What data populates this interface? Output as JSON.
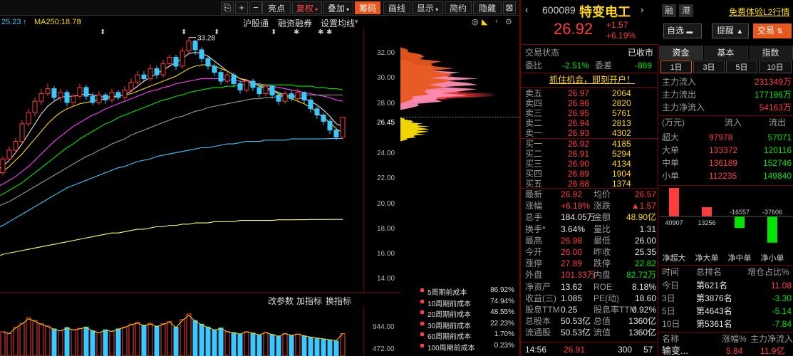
{
  "toolbar": {
    "items": [
      "亮点",
      "复权",
      "叠加",
      "筹码",
      "画线",
      "显示",
      "简约",
      "隐藏"
    ],
    "zoom_in": "+",
    "zoom_out": "−"
  },
  "ma_row": {
    "ma_left": "25.23",
    "ma250": "MA250:18.78",
    "links": [
      "沪股通",
      "融资融券",
      "设置均线"
    ]
  },
  "chart": {
    "ytick_labels": [
      "32.00",
      "30.00",
      "28.00",
      "26.45",
      "24.00",
      "22.00",
      "20.00",
      "18.00",
      "16.00",
      "14.00"
    ],
    "high_label": "33.28",
    "volume_labels": [
      "944.00",
      "472.00"
    ],
    "indicator_buttons": [
      "改参数",
      "加指标",
      "换指标"
    ]
  },
  "chart_data": {
    "type": "candlestick",
    "title": "",
    "ylim": [
      13,
      34
    ],
    "candles": [
      [
        22.5,
        23.6,
        23.8,
        22.3
      ],
      [
        23.6,
        24.3,
        24.6,
        23.4
      ],
      [
        24.3,
        25.0,
        25.3,
        24.1
      ],
      [
        25.0,
        26.4,
        26.7,
        24.8
      ],
      [
        26.4,
        27.3,
        27.6,
        26.2
      ],
      [
        27.3,
        28.2,
        28.5,
        27.0
      ],
      [
        28.2,
        28.8,
        29.2,
        27.9
      ],
      [
        28.8,
        29.2,
        29.6,
        28.6
      ],
      [
        29.2,
        28.5,
        29.4,
        28.2
      ],
      [
        28.5,
        28.9,
        29.2,
        28.2
      ],
      [
        28.9,
        28.1,
        29.1,
        27.8
      ],
      [
        28.1,
        28.6,
        28.8,
        27.8
      ],
      [
        28.6,
        29.3,
        29.6,
        28.4
      ],
      [
        29.3,
        28.6,
        29.5,
        28.3
      ],
      [
        28.6,
        28.1,
        28.9,
        27.9
      ],
      [
        28.1,
        28.7,
        29.0,
        27.9
      ],
      [
        28.7,
        28.3,
        28.9,
        28.0
      ],
      [
        28.3,
        28.9,
        29.2,
        28.1
      ],
      [
        28.9,
        28.5,
        29.1,
        28.3
      ],
      [
        28.5,
        29.1,
        29.4,
        28.3
      ],
      [
        29.1,
        29.7,
        30.0,
        28.9
      ],
      [
        29.7,
        30.3,
        30.6,
        29.5
      ],
      [
        30.3,
        30.0,
        30.6,
        29.7
      ],
      [
        30.0,
        30.8,
        31.1,
        29.8
      ],
      [
        30.8,
        30.3,
        31.0,
        30.0
      ],
      [
        30.3,
        31.2,
        31.5,
        30.1
      ],
      [
        31.2,
        31.7,
        31.9,
        31.0
      ],
      [
        31.7,
        31.0,
        31.9,
        30.7
      ],
      [
        31.0,
        32.2,
        32.5,
        30.8
      ],
      [
        32.2,
        33.0,
        33.28,
        31.9
      ],
      [
        33.0,
        32.3,
        33.1,
        31.9
      ],
      [
        32.3,
        31.6,
        32.5,
        31.3
      ],
      [
        31.6,
        31.0,
        31.8,
        30.7
      ],
      [
        31.0,
        30.5,
        31.2,
        30.2
      ],
      [
        30.5,
        29.8,
        30.7,
        29.5
      ],
      [
        29.8,
        30.3,
        30.6,
        29.6
      ],
      [
        30.3,
        29.6,
        30.5,
        29.3
      ],
      [
        29.6,
        29.1,
        29.8,
        28.8
      ],
      [
        29.1,
        29.8,
        30.0,
        28.9
      ],
      [
        29.8,
        29.3,
        30.0,
        29.0
      ],
      [
        29.3,
        28.8,
        29.5,
        28.5
      ],
      [
        28.8,
        29.4,
        29.6,
        28.6
      ],
      [
        29.4,
        28.7,
        29.5,
        28.4
      ],
      [
        28.7,
        28.2,
        28.9,
        27.9
      ],
      [
        28.2,
        28.8,
        29.0,
        28.0
      ],
      [
        28.8,
        28.4,
        29.1,
        28.2
      ],
      [
        28.4,
        28.9,
        29.2,
        28.2
      ],
      [
        28.9,
        28.3,
        29.0,
        28.0
      ],
      [
        28.3,
        27.6,
        28.5,
        27.3
      ],
      [
        27.6,
        27.1,
        27.8,
        26.8
      ],
      [
        27.1,
        26.6,
        27.3,
        26.3
      ],
      [
        26.6,
        25.9,
        26.8,
        25.6
      ],
      [
        25.9,
        25.35,
        26.1,
        25.1
      ],
      [
        25.35,
        26.92,
        26.98,
        26.0
      ]
    ],
    "ma_lines": [
      {
        "color": "#e6e6e6",
        "values": [
          23.0,
          23.5,
          24.1,
          24.8,
          25.6,
          26.4,
          27.2,
          27.8,
          28.2,
          28.5,
          28.6,
          28.6,
          28.7,
          28.8,
          28.7,
          28.6,
          28.5,
          28.6,
          28.6,
          28.7,
          29.0,
          29.4,
          29.8,
          30.1,
          30.4,
          30.7,
          31.0,
          31.3,
          31.6,
          32.0,
          32.1,
          32.0,
          31.8,
          31.4,
          31.0,
          30.6,
          30.3,
          30.0,
          29.9,
          29.7,
          29.5,
          29.3,
          29.1,
          28.9,
          28.7,
          28.6,
          28.5,
          28.4,
          28.2,
          27.9,
          27.5,
          27.0,
          26.4,
          26.2
        ]
      },
      {
        "color": "#ffd700",
        "values": [
          22.6,
          23.0,
          23.5,
          24.0,
          24.6,
          25.2,
          25.8,
          26.4,
          26.9,
          27.3,
          27.6,
          27.8,
          28.0,
          28.1,
          28.2,
          28.3,
          28.4,
          28.5,
          28.6,
          28.7,
          28.8,
          29.0,
          29.2,
          29.4,
          29.6,
          29.8,
          30.0,
          30.2,
          30.5,
          30.8,
          31.0,
          31.1,
          31.1,
          31.0,
          30.8,
          30.6,
          30.3,
          30.0,
          29.8,
          29.6,
          29.4,
          29.2,
          29.0,
          28.8,
          28.6,
          28.4,
          28.2,
          28.0,
          27.7,
          27.3,
          26.9,
          26.5,
          26.0,
          25.7
        ]
      },
      {
        "color": "#ff3cff",
        "values": [
          21.6,
          21.9,
          22.2,
          22.6,
          23.0,
          23.5,
          24.0,
          24.5,
          25.0,
          25.4,
          25.8,
          26.2,
          26.5,
          26.8,
          27.1,
          27.3,
          27.6,
          27.8,
          28.0,
          28.2,
          28.4,
          28.6,
          28.8,
          29.0,
          29.1,
          29.3,
          29.4,
          29.6,
          29.7,
          29.8,
          29.9,
          30.0,
          30.0,
          30.0,
          30.0,
          29.9,
          29.9,
          29.8,
          29.7,
          29.6,
          29.6,
          29.5,
          29.4,
          29.3,
          29.2,
          29.1,
          29.0,
          28.9,
          28.8,
          28.7,
          28.6,
          28.5,
          28.3,
          28.2
        ]
      },
      {
        "color": "#00e600",
        "values": [
          20.8,
          21.1,
          21.4,
          21.7,
          22.1,
          22.5,
          22.9,
          23.3,
          23.7,
          24.1,
          24.5,
          24.8,
          25.2,
          25.5,
          25.8,
          26.1,
          26.4,
          26.6,
          26.9,
          27.1,
          27.3,
          27.5,
          27.7,
          27.9,
          28.1,
          28.3,
          28.4,
          28.6,
          28.7,
          28.9,
          29.0,
          29.1,
          29.2,
          29.3,
          29.3,
          29.4,
          29.4,
          29.5,
          29.5,
          29.5,
          29.5,
          29.5,
          29.5,
          29.5,
          29.5,
          29.5,
          29.4,
          29.4,
          29.4,
          29.3,
          29.3,
          29.2,
          29.2,
          29.1
        ]
      },
      {
        "color": "#9a9a9a",
        "values": [
          20.0,
          20.2,
          20.5,
          20.8,
          21.1,
          21.4,
          21.7,
          22.0,
          22.3,
          22.6,
          22.9,
          23.2,
          23.5,
          23.8,
          24.0,
          24.3,
          24.5,
          24.8,
          25.0,
          25.2,
          25.5,
          25.7,
          25.9,
          26.1,
          26.3,
          26.5,
          26.7,
          26.9,
          27.0,
          27.2,
          27.4,
          27.5,
          27.7,
          27.8,
          27.9,
          28.0,
          28.1,
          28.2,
          28.3,
          28.4,
          28.4,
          28.5,
          28.5,
          28.6,
          28.6,
          28.6,
          28.7,
          28.7,
          28.7,
          28.7,
          28.7,
          28.7,
          28.7,
          28.7
        ]
      },
      {
        "color": "#3cc8ff",
        "values": [
          18.3,
          18.6,
          18.9,
          19.2,
          19.5,
          19.8,
          20.1,
          20.4,
          20.7,
          21.0,
          21.3,
          21.5,
          21.7,
          21.9,
          22.1,
          22.3,
          22.5,
          22.7,
          22.9,
          23.0,
          23.2,
          23.4,
          23.5,
          23.6,
          23.8,
          23.9,
          24.0,
          24.1,
          24.2,
          24.3,
          24.4,
          24.5,
          24.5,
          24.6,
          24.7,
          24.8,
          24.8,
          24.9,
          25.0,
          25.0,
          25.0,
          25.1,
          25.1,
          25.1,
          25.1,
          25.2,
          25.2,
          25.2,
          25.2,
          25.2,
          25.2,
          25.23,
          25.23,
          25.23
        ]
      },
      {
        "color": "#ffff66",
        "values": [
          16.0,
          16.1,
          16.2,
          16.3,
          16.4,
          16.5,
          16.6,
          16.7,
          16.8,
          16.9,
          17.0,
          17.1,
          17.2,
          17.3,
          17.4,
          17.5,
          17.6,
          17.7,
          17.7,
          17.8,
          17.9,
          18.0,
          18.0,
          18.1,
          18.2,
          18.2,
          18.3,
          18.3,
          18.4,
          18.4,
          18.5,
          18.5,
          18.5,
          18.6,
          18.6,
          18.6,
          18.6,
          18.7,
          18.7,
          18.7,
          18.7,
          18.7,
          18.7,
          18.75,
          18.75,
          18.75,
          18.76,
          18.76,
          18.77,
          18.77,
          18.77,
          18.78,
          18.78,
          18.78
        ]
      }
    ],
    "volumes": [
      520,
      480,
      610,
      700,
      820,
      760,
      690,
      640,
      580,
      540,
      610,
      560,
      590,
      620,
      540,
      500,
      560,
      530,
      580,
      620,
      680,
      720,
      660,
      700,
      640,
      690,
      740,
      620,
      780,
      900,
      760,
      680,
      620,
      560,
      600,
      520,
      500,
      470,
      520,
      490,
      450,
      500,
      460,
      420,
      480,
      440,
      470,
      430,
      400,
      380,
      360,
      340,
      320,
      480
    ],
    "chip_bands": [
      {
        "color": "#ff3c3c",
        "from": 28.2,
        "to": 29.2,
        "peak": 1.0
      },
      {
        "color": "#ff8cb4",
        "from": 27.5,
        "to": 31.5,
        "peak": 0.8
      },
      {
        "color": "#e8581d",
        "from": 28.0,
        "to": 32.5,
        "peak": 0.55
      },
      {
        "color": "#ffe000",
        "from": 25.0,
        "to": 26.9,
        "peak": 0.3
      }
    ]
  },
  "cost_legend": [
    {
      "label": "5周期前成本",
      "pct": "86.92%"
    },
    {
      "label": "10周期前成本",
      "pct": "74.94%"
    },
    {
      "label": "20周期前成本",
      "pct": "48.55%"
    },
    {
      "label": "30周期前成本",
      "pct": "22.23%"
    },
    {
      "label": "60周期前成本",
      "pct": "1.70%"
    },
    {
      "label": "100周期前成本",
      "pct": "0.23%"
    }
  ],
  "stock": {
    "code": "600089",
    "name": "特变电工",
    "badges": [
      "融",
      "港"
    ],
    "l2_link": "免费体验L2行情",
    "price": "26.92",
    "change": "+1.57",
    "change_pct": "+6.19%",
    "self_select": "自选",
    "remind": "提醒",
    "trade": "交易"
  },
  "status": {
    "label": "交易状态",
    "value": "已收市",
    "weibi_label": "委比",
    "weibi": "-2.51%",
    "weicha_label": "委差",
    "weicha": "-869",
    "banner": "抓住机会，即刻开户！"
  },
  "asks": [
    {
      "label": "卖五",
      "price": "26.97",
      "vol": "2064"
    },
    {
      "label": "卖四",
      "price": "26.96",
      "vol": "2820"
    },
    {
      "label": "卖三",
      "price": "26.95",
      "vol": "5761"
    },
    {
      "label": "卖二",
      "price": "26.94",
      "vol": "2813"
    },
    {
      "label": "卖一",
      "price": "26.93",
      "vol": "4302"
    }
  ],
  "bids": [
    {
      "label": "买一",
      "price": "26.92",
      "vol": "4185"
    },
    {
      "label": "买二",
      "price": "26.91",
      "vol": "5294"
    },
    {
      "label": "买三",
      "price": "26.90",
      "vol": "4134"
    },
    {
      "label": "买四",
      "price": "26.89",
      "vol": "1904"
    },
    {
      "label": "买五",
      "price": "26.88",
      "vol": "1374"
    }
  ],
  "quote": [
    {
      "l1": "最新",
      "v1": "26.92",
      "l2": "均价",
      "v2": "26.57"
    },
    {
      "l1": "涨幅",
      "v1": "+6.19%",
      "l2": "涨跌",
      "v2": "▲1.57"
    },
    {
      "l1": "总手",
      "v1": "184.05万",
      "l2": "金额",
      "v2": "48.90亿"
    },
    {
      "l1": "换手*",
      "v1": "3.64%",
      "l2": "量比",
      "v2": "1.31"
    },
    {
      "l1": "最高",
      "v1": "26.98",
      "l2": "最低",
      "v2": "26.00"
    },
    {
      "l1": "今开",
      "v1": "26.00",
      "l2": "昨收",
      "v2": "25.35"
    },
    {
      "l1": "涨停",
      "v1": "27.89",
      "l2": "跌停",
      "v2": "22.82"
    },
    {
      "l1": "外盘",
      "v1": "101.33万",
      "l2": "内盘",
      "v2": "82.72万"
    },
    {
      "l1": "净资产",
      "v1": "13.62",
      "l2": "ROE",
      "v2": "8.18%"
    },
    {
      "l1": "收益(三)",
      "v1": "1.085",
      "l2": "PE(动)",
      "v2": "18.60"
    },
    {
      "l1": "股息TTM",
      "v1": "0.25",
      "l2": "股息率TTM",
      "v2": "0.92%"
    },
    {
      "l1": "总股本",
      "v1": "50.53亿",
      "l2": "总值",
      "v2": "1360亿"
    },
    {
      "l1": "流通股",
      "v1": "50.53亿",
      "l2": "流值",
      "v2": "1360亿"
    }
  ],
  "tick": {
    "time": "14:56",
    "price": "26.91",
    "vol": "300",
    "count": "57"
  },
  "fund": {
    "tabs": [
      "资金",
      "基本",
      "指数"
    ],
    "periods": [
      "1日",
      "3日",
      "5日",
      "10日"
    ],
    "rows": [
      {
        "label": "主力流入",
        "value": "231349万"
      },
      {
        "label": "主力流出",
        "value": "177186万"
      },
      {
        "label": "主力净流入",
        "value": "54163万"
      }
    ],
    "table_head": [
      "(万元)",
      "流入",
      "流出"
    ],
    "table": [
      {
        "label": "超大",
        "in": "97978",
        "out": "57071"
      },
      {
        "label": "大单",
        "in": "133372",
        "out": "120116"
      },
      {
        "label": "中单",
        "in": "136189",
        "out": "152746"
      },
      {
        "label": "小单",
        "in": "112235",
        "out": "149840"
      }
    ],
    "bar_chart": {
      "type": "bar",
      "categories": [
        "净超大",
        "净大单",
        "净中单",
        "净小单"
      ],
      "values": [
        40907,
        13256,
        -16557,
        -37606
      ],
      "labels": [
        "40907",
        "13256",
        "-16557",
        "-37606"
      ]
    },
    "rank_head": [
      "时间",
      "总排名",
      "增仓占比%"
    ],
    "rank": [
      {
        "t": "今日",
        "r": "第621名",
        "v": "11.08"
      },
      {
        "t": "3日",
        "r": "第3876名",
        "v": "-3.30"
      },
      {
        "t": "5日",
        "r": "第4643名",
        "v": "-5.14"
      },
      {
        "t": "10日",
        "r": "第5361名",
        "v": "-7.84"
      }
    ],
    "bottom_head": [
      "名称",
      "涨幅%",
      "主力净流入"
    ],
    "bottom_row": {
      "name": "输变...",
      "chg": "5.84",
      "net": "11.9亿"
    }
  },
  "colors": {
    "up": "#ff3c3c",
    "down": "#00e600",
    "accent": "#e8581d",
    "divider": "#7a0000"
  }
}
